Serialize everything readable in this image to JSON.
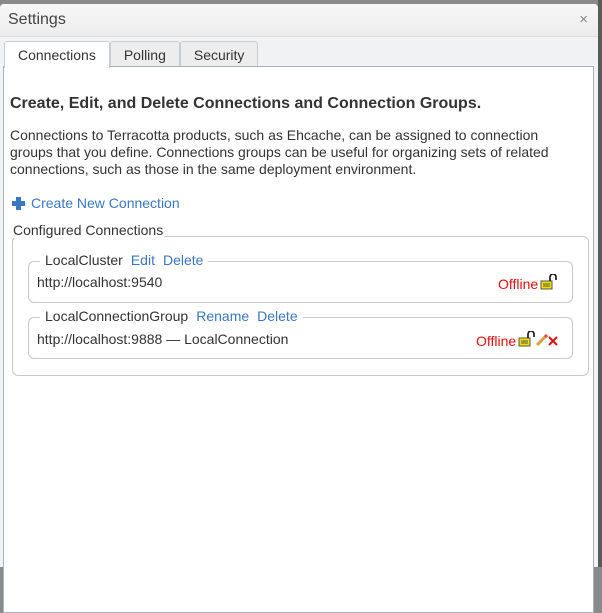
{
  "dialog": {
    "title": "Settings",
    "close_label": "×"
  },
  "tabs": [
    {
      "label": "Connections",
      "active": true
    },
    {
      "label": "Polling",
      "active": false
    },
    {
      "label": "Security",
      "active": false
    }
  ],
  "connections_tab": {
    "heading": "Create, Edit, and Delete Connections and Connection Groups.",
    "description": "Connections to Terracotta products, such as Ehcache, can be assigned to connection groups that you define. Connections groups can be useful for organizing sets of related connections, such as those in the same deployment environment.",
    "create_label": "Create New Connection",
    "configured_legend": "Configured Connections",
    "connections": [
      {
        "name": "LocalCluster",
        "actions": [
          "Edit",
          "Delete"
        ],
        "url": "http://localhost:9540",
        "status": "Offline",
        "icons": [
          "unlock-icon"
        ]
      },
      {
        "name": "LocalConnectionGroup",
        "actions": [
          "Rename",
          "Delete"
        ],
        "url": "http://localhost:9888 — LocalConnection",
        "status": "Offline",
        "icons": [
          "unlock-icon",
          "edit-icon",
          "delete-icon"
        ]
      }
    ]
  },
  "colors": {
    "link": "#3a78c3",
    "offline": "#e01010"
  }
}
